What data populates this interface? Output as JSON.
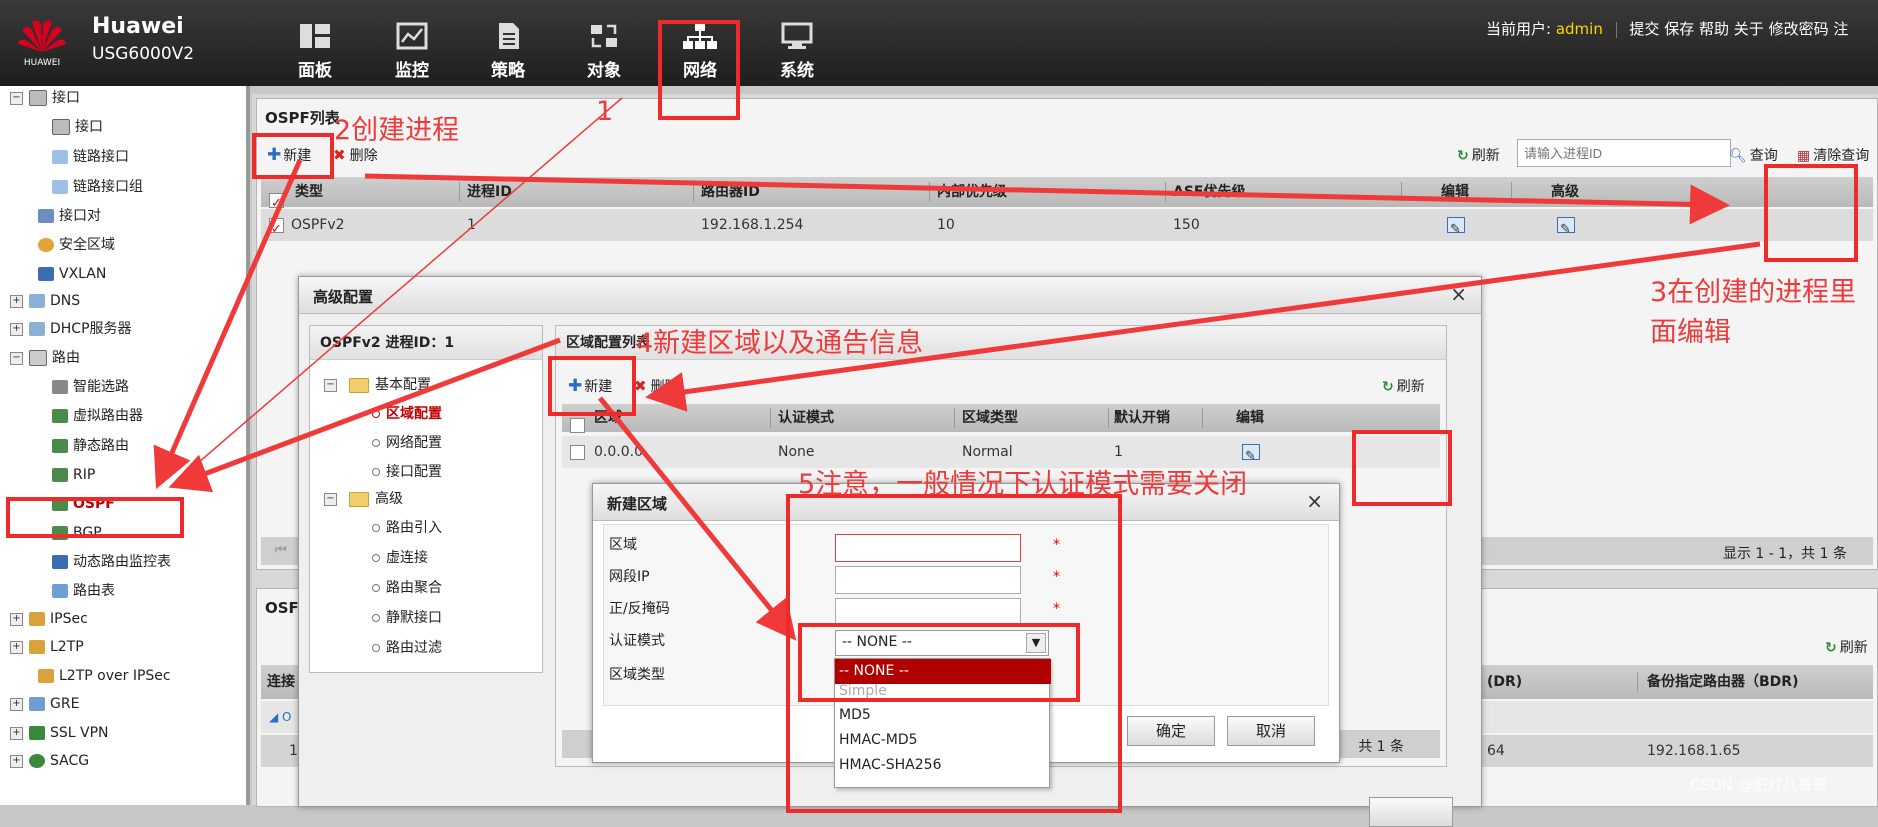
{
  "header": {
    "brand_logo_text": "HUAWEI",
    "brand_name": "Huawei",
    "model": "USG6000V2",
    "nav": [
      {
        "label": "面板",
        "icon": "dashboard-icon"
      },
      {
        "label": "监控",
        "icon": "monitor-icon"
      },
      {
        "label": "策略",
        "icon": "policy-icon"
      },
      {
        "label": "对象",
        "icon": "object-icon"
      },
      {
        "label": "网络",
        "icon": "network-icon"
      },
      {
        "label": "系统",
        "icon": "system-icon"
      }
    ],
    "current_user_label": "当前用户:",
    "current_user": "admin",
    "links": [
      "提交",
      "保存",
      "帮助",
      "关于",
      "修改密码",
      "注"
    ]
  },
  "sidebar": {
    "items": [
      {
        "label": "接口",
        "toggle": "−"
      },
      {
        "label": "接口"
      },
      {
        "label": "链路接口"
      },
      {
        "label": "链路接口组"
      },
      {
        "label": "接口对"
      },
      {
        "label": "安全区域"
      },
      {
        "label": "VXLAN"
      },
      {
        "label": "DNS",
        "toggle": "+"
      },
      {
        "label": "DHCP服务器",
        "toggle": "+"
      },
      {
        "label": "路由",
        "toggle": "−"
      },
      {
        "label": "智能选路"
      },
      {
        "label": "虚拟路由器"
      },
      {
        "label": "静态路由"
      },
      {
        "label": "RIP"
      },
      {
        "label": "OSPF"
      },
      {
        "label": "BGP"
      },
      {
        "label": "动态路由监控表"
      },
      {
        "label": "路由表"
      },
      {
        "label": "IPSec",
        "toggle": "+"
      },
      {
        "label": "L2TP",
        "toggle": "+"
      },
      {
        "label": "L2TP over IPSec"
      },
      {
        "label": "GRE",
        "toggle": "+"
      },
      {
        "label": "SSL VPN",
        "toggle": "+"
      },
      {
        "label": "SACG",
        "toggle": "+"
      }
    ]
  },
  "ospf_list": {
    "title": "OSPF列表",
    "new_label": "新建",
    "delete_label": "删除",
    "refresh_label": "刷新",
    "search_placeholder": "请输入进程ID",
    "query_label": "查询",
    "clear_query_label": "清除查询",
    "columns": [
      "类型",
      "进程ID",
      "路由器ID",
      "内部优先级",
      "ASE优先级",
      "编辑",
      "高级"
    ],
    "rows": [
      {
        "type": "OSPFv2",
        "process_id": "1",
        "router_id": "192.168.1.254",
        "internal_priority": "10",
        "ase_priority": "150"
      }
    ],
    "footer": "显示 1 - 1，共 1 条"
  },
  "lower_panel": {
    "title": "OSF",
    "refresh_label": "刷新",
    "col_first": "连接",
    "col_dr": "(DR)",
    "col_bdr": "备份指定路由器（BDR)",
    "group_mark": "◢ O",
    "row_first": "1(",
    "row_dr": "64",
    "row_bdr": "192.168.1.65"
  },
  "advanced_dialog": {
    "title": "高级配置",
    "close": "×",
    "process_header": "OSPFv2 进程ID：1",
    "tree": {
      "basic": "基本配置",
      "basic_items": [
        "区域配置",
        "网络配置",
        "接口配置"
      ],
      "advanced": "高级",
      "advanced_items": [
        "路由引入",
        "虚连接",
        "路由聚合",
        "静默接口",
        "路由过滤"
      ]
    },
    "area_list": {
      "title": "区域配置列表",
      "new_label": "新建",
      "delete_label": "删除",
      "refresh_label": "刷新",
      "columns": [
        "区域",
        "认证模式",
        "区域类型",
        "默认开销",
        "编辑"
      ],
      "rows": [
        {
          "area": "0.0.0.0",
          "auth": "None",
          "type": "Normal",
          "cost": "1"
        }
      ],
      "footer": "共 1 条"
    }
  },
  "new_area_dialog": {
    "title": "新建区域",
    "close": "×",
    "fields": {
      "area_label": "区域",
      "segment_ip_label": "网段IP",
      "mask_label": "正/反掩码",
      "auth_mode_label": "认证模式",
      "area_type_label": "区域类型"
    },
    "required_mark": "*",
    "auth_mode_value": "-- NONE --",
    "auth_mode_options": [
      "-- NONE --",
      "Simple",
      "MD5",
      "HMAC-MD5",
      "HMAC-SHA256"
    ],
    "ok_label": "确定",
    "cancel_label": "取消"
  },
  "annotations": {
    "a1": "1",
    "a2": "2创建进程",
    "a3_line1": "3在创建的进程里",
    "a3_line2": "面编辑",
    "a4": "4新建区域以及通告信息",
    "a5": "5注意，一般情况下认证模式需要关闭"
  },
  "watermark": "CSDN @肥灯儿哥哥",
  "colors": {
    "annotation_red": "#f03a3a",
    "selected_option": "#b00000",
    "admin_yellow": "#ffd400"
  }
}
